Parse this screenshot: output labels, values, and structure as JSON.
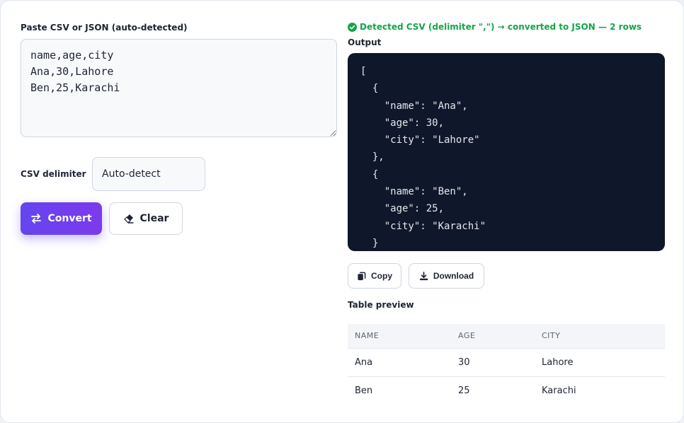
{
  "input": {
    "label": "Paste CSV or JSON (auto-detected)",
    "value": "name,age,city\nAna,30,Lahore\nBen,25,Karachi"
  },
  "delimiter": {
    "label": "CSV delimiter",
    "value": "Auto-detect"
  },
  "actions": {
    "convert_label": "Convert",
    "clear_label": "Clear"
  },
  "status": {
    "text": "Detected CSV (delimiter \",\") → converted to JSON — 2 rows",
    "color": "#16a34a"
  },
  "output": {
    "label": "Output",
    "code": "[\n  {\n    \"name\": \"Ana\",\n    \"age\": 30,\n    \"city\": \"Lahore\"\n  },\n  {\n    \"name\": \"Ben\",\n    \"age\": 25,\n    \"city\": \"Karachi\"\n  }\n]",
    "copy_label": "Copy",
    "download_label": "Download"
  },
  "preview": {
    "label": "Table preview",
    "columns": [
      "NAME",
      "AGE",
      "CITY"
    ],
    "rows": [
      [
        "Ana",
        "30",
        "Lahore"
      ],
      [
        "Ben",
        "25",
        "Karachi"
      ]
    ]
  },
  "colors": {
    "accent": "#6446ee",
    "code_bg": "#0f172a"
  }
}
